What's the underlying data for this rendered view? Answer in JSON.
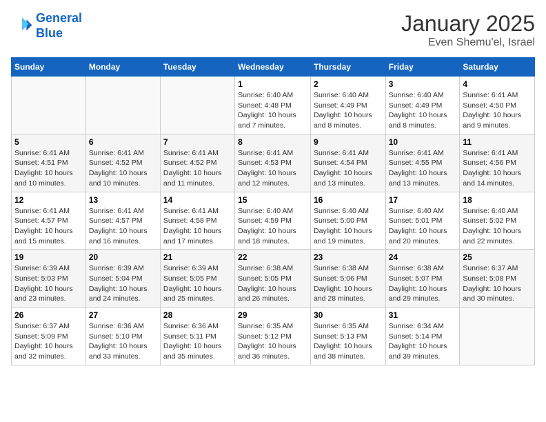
{
  "header": {
    "logo_line1": "General",
    "logo_line2": "Blue",
    "month_title": "January 2025",
    "subtitle": "Even Shemu'el, Israel"
  },
  "days_of_week": [
    "Sunday",
    "Monday",
    "Tuesday",
    "Wednesday",
    "Thursday",
    "Friday",
    "Saturday"
  ],
  "weeks": [
    [
      {
        "day": "",
        "info": ""
      },
      {
        "day": "",
        "info": ""
      },
      {
        "day": "",
        "info": ""
      },
      {
        "day": "1",
        "info": "Sunrise: 6:40 AM\nSunset: 4:48 PM\nDaylight: 10 hours\nand 7 minutes."
      },
      {
        "day": "2",
        "info": "Sunrise: 6:40 AM\nSunset: 4:49 PM\nDaylight: 10 hours\nand 8 minutes."
      },
      {
        "day": "3",
        "info": "Sunrise: 6:40 AM\nSunset: 4:49 PM\nDaylight: 10 hours\nand 8 minutes."
      },
      {
        "day": "4",
        "info": "Sunrise: 6:41 AM\nSunset: 4:50 PM\nDaylight: 10 hours\nand 9 minutes."
      }
    ],
    [
      {
        "day": "5",
        "info": "Sunrise: 6:41 AM\nSunset: 4:51 PM\nDaylight: 10 hours\nand 10 minutes."
      },
      {
        "day": "6",
        "info": "Sunrise: 6:41 AM\nSunset: 4:52 PM\nDaylight: 10 hours\nand 10 minutes."
      },
      {
        "day": "7",
        "info": "Sunrise: 6:41 AM\nSunset: 4:52 PM\nDaylight: 10 hours\nand 11 minutes."
      },
      {
        "day": "8",
        "info": "Sunrise: 6:41 AM\nSunset: 4:53 PM\nDaylight: 10 hours\nand 12 minutes."
      },
      {
        "day": "9",
        "info": "Sunrise: 6:41 AM\nSunset: 4:54 PM\nDaylight: 10 hours\nand 13 minutes."
      },
      {
        "day": "10",
        "info": "Sunrise: 6:41 AM\nSunset: 4:55 PM\nDaylight: 10 hours\nand 13 minutes."
      },
      {
        "day": "11",
        "info": "Sunrise: 6:41 AM\nSunset: 4:56 PM\nDaylight: 10 hours\nand 14 minutes."
      }
    ],
    [
      {
        "day": "12",
        "info": "Sunrise: 6:41 AM\nSunset: 4:57 PM\nDaylight: 10 hours\nand 15 minutes."
      },
      {
        "day": "13",
        "info": "Sunrise: 6:41 AM\nSunset: 4:57 PM\nDaylight: 10 hours\nand 16 minutes."
      },
      {
        "day": "14",
        "info": "Sunrise: 6:41 AM\nSunset: 4:58 PM\nDaylight: 10 hours\nand 17 minutes."
      },
      {
        "day": "15",
        "info": "Sunrise: 6:40 AM\nSunset: 4:59 PM\nDaylight: 10 hours\nand 18 minutes."
      },
      {
        "day": "16",
        "info": "Sunrise: 6:40 AM\nSunset: 5:00 PM\nDaylight: 10 hours\nand 19 minutes."
      },
      {
        "day": "17",
        "info": "Sunrise: 6:40 AM\nSunset: 5:01 PM\nDaylight: 10 hours\nand 20 minutes."
      },
      {
        "day": "18",
        "info": "Sunrise: 6:40 AM\nSunset: 5:02 PM\nDaylight: 10 hours\nand 22 minutes."
      }
    ],
    [
      {
        "day": "19",
        "info": "Sunrise: 6:39 AM\nSunset: 5:03 PM\nDaylight: 10 hours\nand 23 minutes."
      },
      {
        "day": "20",
        "info": "Sunrise: 6:39 AM\nSunset: 5:04 PM\nDaylight: 10 hours\nand 24 minutes."
      },
      {
        "day": "21",
        "info": "Sunrise: 6:39 AM\nSunset: 5:05 PM\nDaylight: 10 hours\nand 25 minutes."
      },
      {
        "day": "22",
        "info": "Sunrise: 6:38 AM\nSunset: 5:05 PM\nDaylight: 10 hours\nand 26 minutes."
      },
      {
        "day": "23",
        "info": "Sunrise: 6:38 AM\nSunset: 5:06 PM\nDaylight: 10 hours\nand 28 minutes."
      },
      {
        "day": "24",
        "info": "Sunrise: 6:38 AM\nSunset: 5:07 PM\nDaylight: 10 hours\nand 29 minutes."
      },
      {
        "day": "25",
        "info": "Sunrise: 6:37 AM\nSunset: 5:08 PM\nDaylight: 10 hours\nand 30 minutes."
      }
    ],
    [
      {
        "day": "26",
        "info": "Sunrise: 6:37 AM\nSunset: 5:09 PM\nDaylight: 10 hours\nand 32 minutes."
      },
      {
        "day": "27",
        "info": "Sunrise: 6:36 AM\nSunset: 5:10 PM\nDaylight: 10 hours\nand 33 minutes."
      },
      {
        "day": "28",
        "info": "Sunrise: 6:36 AM\nSunset: 5:11 PM\nDaylight: 10 hours\nand 35 minutes."
      },
      {
        "day": "29",
        "info": "Sunrise: 6:35 AM\nSunset: 5:12 PM\nDaylight: 10 hours\nand 36 minutes."
      },
      {
        "day": "30",
        "info": "Sunrise: 6:35 AM\nSunset: 5:13 PM\nDaylight: 10 hours\nand 38 minutes."
      },
      {
        "day": "31",
        "info": "Sunrise: 6:34 AM\nSunset: 5:14 PM\nDaylight: 10 hours\nand 39 minutes."
      },
      {
        "day": "",
        "info": ""
      }
    ]
  ]
}
